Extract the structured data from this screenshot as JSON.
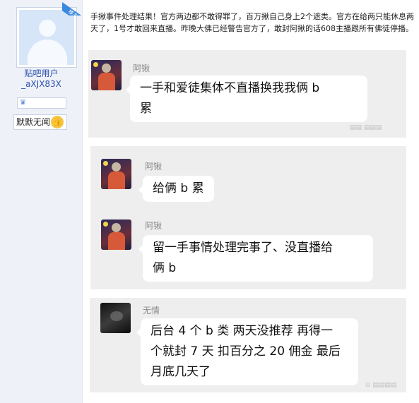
{
  "user": {
    "username_line1": "贴吧用户",
    "username_line2": "_aXJX83X",
    "rank_label": "默默无闻",
    "corner_badge": "楼主"
  },
  "post": {
    "text": "手揪事件处理结果！官方两边都不敢得罪了，百万揪自己身上2个遮类。官方在给两只能休息两天了，1号才敢回来直播。昨晚大佛已经警告官方了，敢封阿揪的话608主播跟所有佛徒停播。"
  },
  "chats": [
    {
      "messages": [
        {
          "sender": "阿锹",
          "lines": [
            "一手和爱徒集体不直播换我我俩 b",
            "累"
          ]
        }
      ]
    },
    {
      "messages": [
        {
          "sender": "阿锹",
          "lines": [
            "给俩 b 累"
          ]
        },
        {
          "sender": "阿锹",
          "lines": [
            "留一手事情处理完事了、没直播给",
            "俩 b"
          ]
        }
      ]
    },
    {
      "messages": [
        {
          "sender": "无情",
          "lines": [
            "后台 4 个 b 类  两天没推荐  再得一",
            "个就封 7 天  扣百分之 20 佣金  最后",
            "月底几天了"
          ]
        }
      ]
    }
  ],
  "icons": {
    "level": "crown-level-icon",
    "rank": "thumbs-up-icon"
  }
}
